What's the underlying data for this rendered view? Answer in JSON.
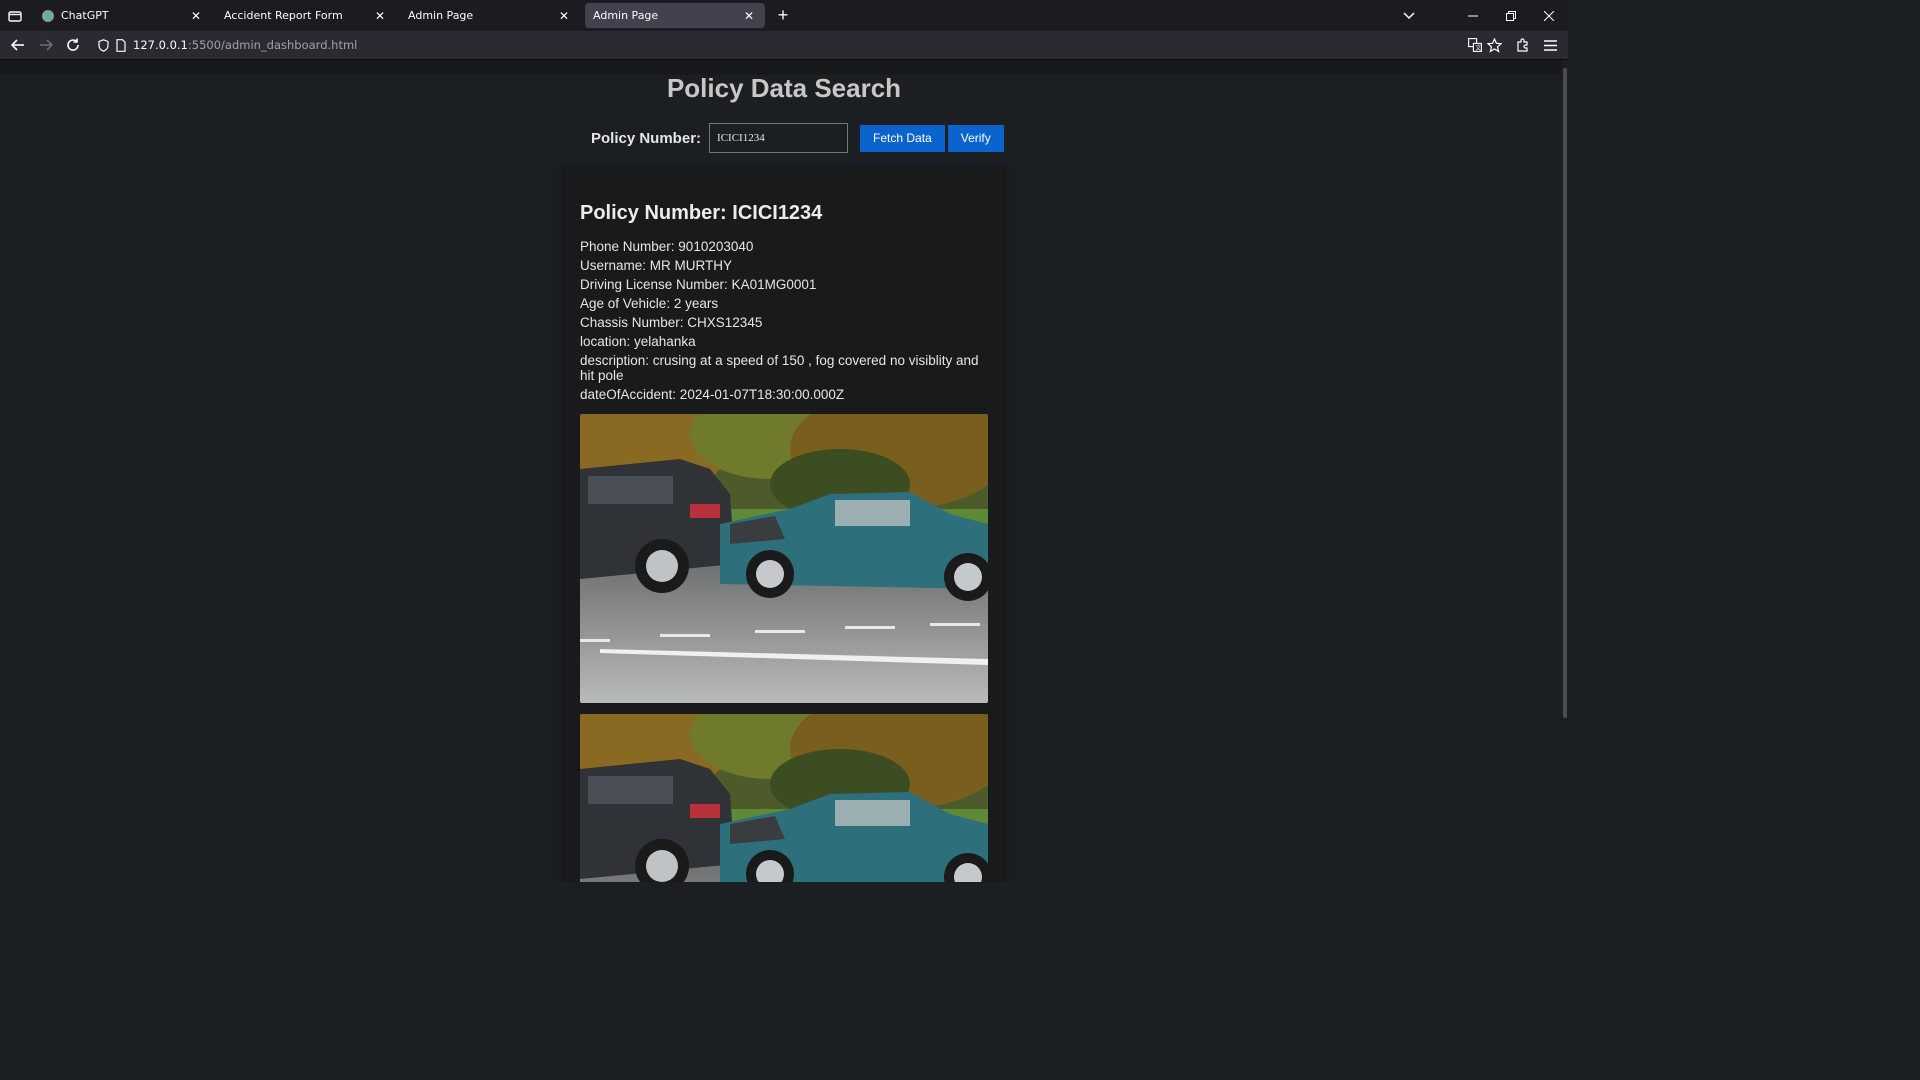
{
  "browser": {
    "tabs": [
      {
        "label": "ChatGPT",
        "active": false
      },
      {
        "label": "Accident Report Form",
        "active": false
      },
      {
        "label": "Admin Page",
        "active": false
      },
      {
        "label": "Admin Page",
        "active": true
      }
    ],
    "url_host": "127.0.0.1",
    "url_path": ":5500/admin_dashboard.html"
  },
  "page": {
    "title": "Policy Data Search",
    "search": {
      "label": "Policy Number:",
      "value": "ICICI1234",
      "fetch_label": "Fetch Data",
      "verify_label": "Verify"
    },
    "record": {
      "heading": "Policy Number: ICICI1234",
      "fields": [
        "Phone Number: 9010203040",
        "Username: MR MURTHY",
        "Driving License Number: KA01MG0001",
        "Age of Vehicle: 2 years",
        "Chassis Number: CHXS12345",
        "location: yelahanka",
        "description: crusing at a speed of 150 , fog covered no visiblity and hit pole",
        "dateOfAccident: 2024-01-07T18:30:00.000Z"
      ],
      "photos": [
        "accident-photo",
        "accident-photo"
      ]
    }
  },
  "colors": {
    "button_blue": "#0b63ce",
    "page_bg": "#1b1f21",
    "card_bg": "#181a1b"
  }
}
